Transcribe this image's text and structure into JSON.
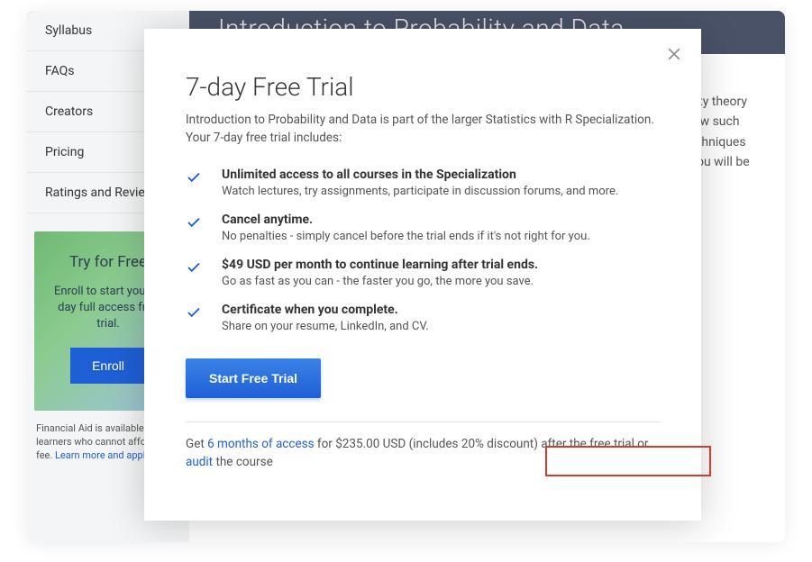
{
  "course_title": "Introduction to Probability and Data",
  "sidebar": {
    "items": [
      {
        "label": "Syllabus"
      },
      {
        "label": "FAQs"
      },
      {
        "label": "Creators"
      },
      {
        "label": "Pricing"
      },
      {
        "label": "Ratings and Reviews"
      }
    ]
  },
  "promo": {
    "title": "Try for Free",
    "desc": "Enroll to start your 7-day full access free trial.",
    "button": "Enroll"
  },
  "fin_aid": {
    "line1": "Financial Aid is available for learners who cannot afford the fee.",
    "link": "Learn more and apply."
  },
  "content": {
    "desc": "This course introduces you to sampling and exploring data, as well as basic probability theory and Bayes' rule. You will examine various types of sampling methods, and discuss how such methods can impact the scope of inference. A variety of exploratory data analysis techniques will be covered, including numeric summary statistics and basic data visualization. You will be guided through"
  },
  "modal": {
    "title": "7-day Free Trial",
    "subtitle": "Introduction to Probability and Data is part of the larger Statistics with R Specialization. Your 7-day free trial includes:",
    "benefits": [
      {
        "title": "Unlimited access to all courses in the Specialization",
        "desc": "Watch lectures, try assignments, participate in discussion forums, and more."
      },
      {
        "title": "Cancel anytime.",
        "desc": "No penalties - simply cancel before the trial ends if it's not right for you."
      },
      {
        "title": "$49 USD per month to continue learning after trial ends.",
        "desc": "Go as fast as you can - the faster you go, the more you save."
      },
      {
        "title": "Certificate when you complete.",
        "desc": "Share on your resume, LinkedIn, and CV."
      }
    ],
    "cta": "Start Free Trial",
    "footer": {
      "pre": "Get ",
      "link1": "6 months of access",
      "mid": " for $235.00 USD (includes 20% discount) after the free trial or ",
      "link2": "audit",
      "post": " the course"
    }
  }
}
